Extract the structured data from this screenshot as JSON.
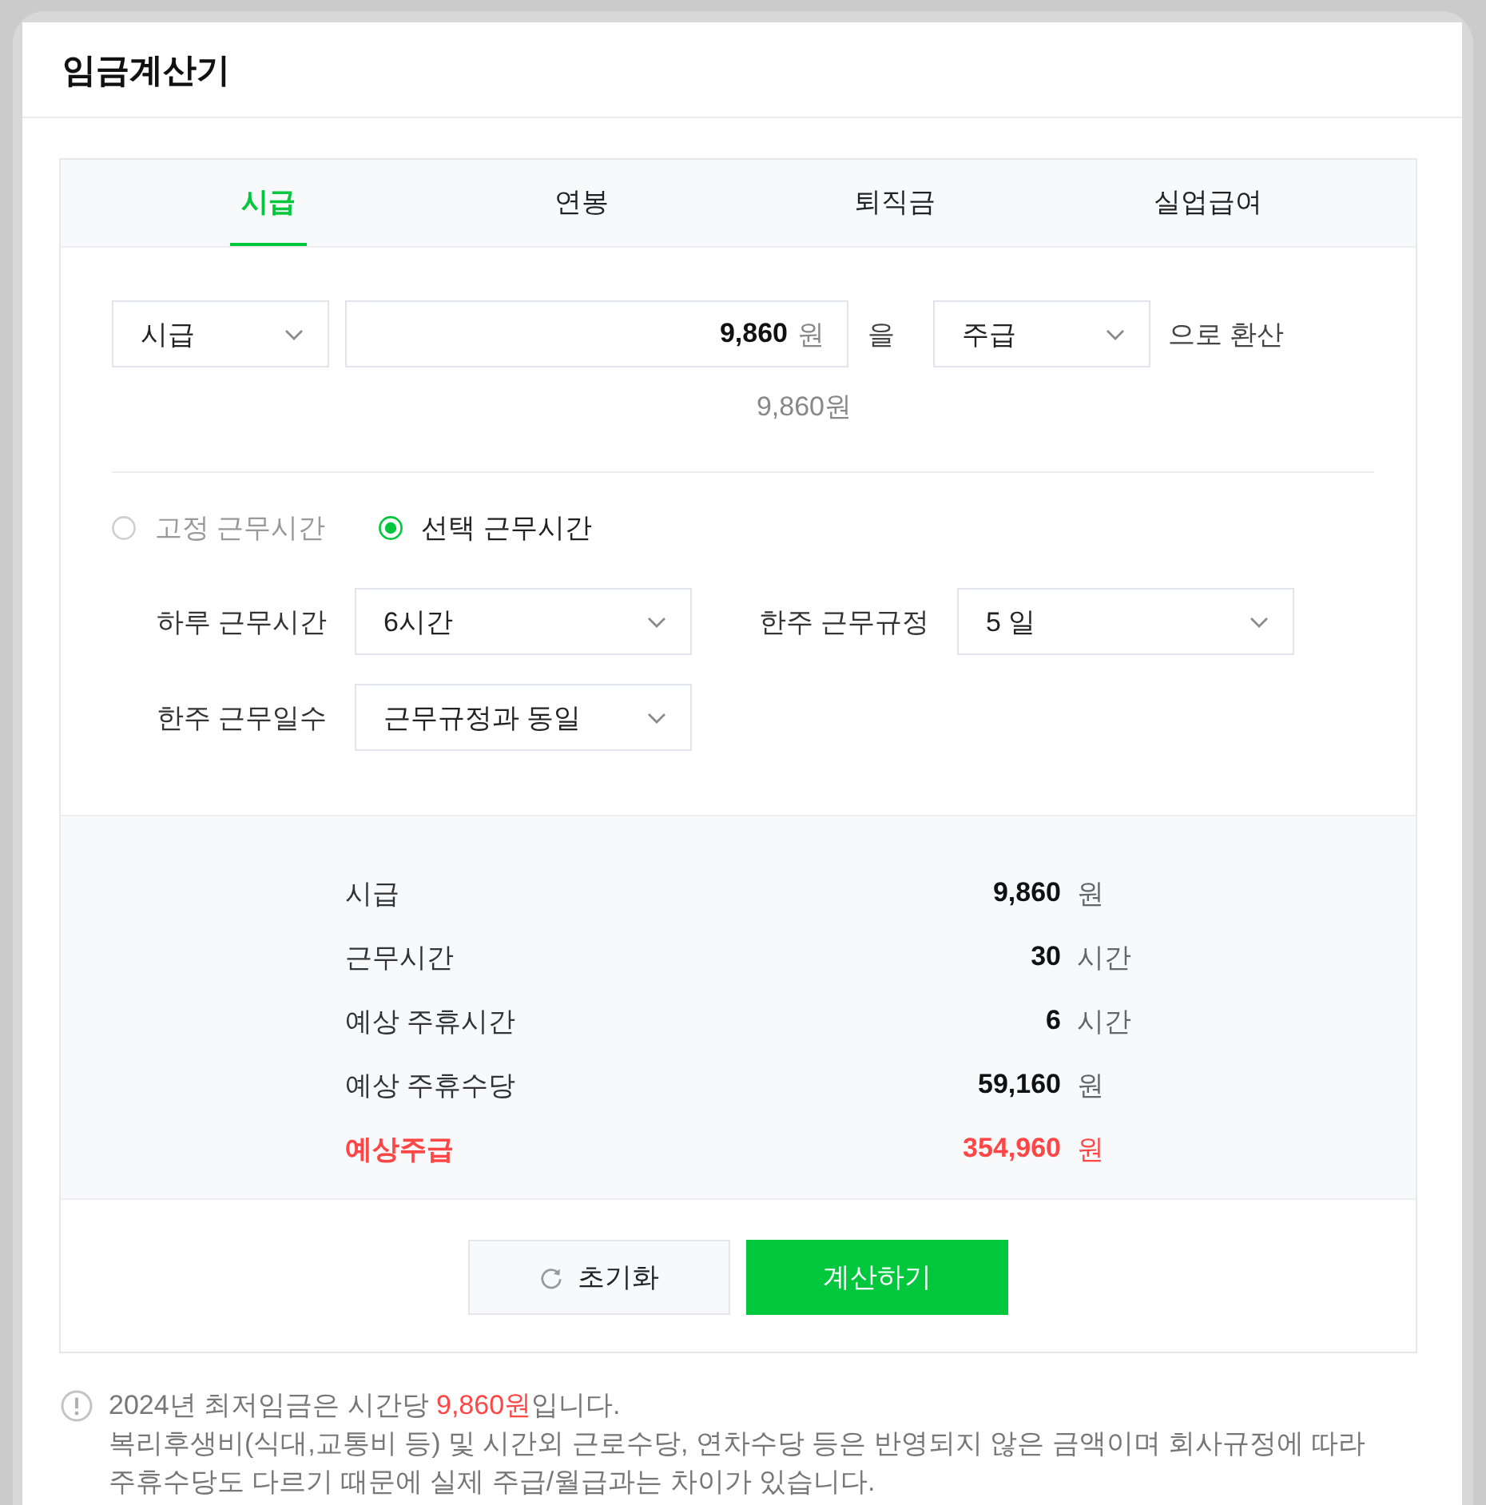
{
  "window": {
    "title": "임금계산기"
  },
  "tabs": [
    {
      "label": "시급",
      "selected": true
    },
    {
      "label": "연봉",
      "selected": false
    },
    {
      "label": "퇴직금",
      "selected": false
    },
    {
      "label": "실업급여",
      "selected": false
    }
  ],
  "converter": {
    "from_select": {
      "value": "시급"
    },
    "amount": {
      "value": "9,860",
      "unit": "원"
    },
    "particle": "을",
    "to_select": {
      "value": "주급"
    },
    "suffix": "으로 환산",
    "amount_preview": "9,860원"
  },
  "work_type": [
    {
      "label": "고정 근무시간",
      "selected": false
    },
    {
      "label": "선택 근무시간",
      "selected": true
    }
  ],
  "fields": [
    {
      "label": "하루 근무시간",
      "value": "6시간"
    },
    {
      "label": "한주 근무규정",
      "value": "5 일"
    },
    {
      "label": "한주 근무일수",
      "value": "근무규정과 동일"
    }
  ],
  "results": [
    {
      "label": "시급",
      "value": "9,860",
      "unit": "원",
      "highlight": false
    },
    {
      "label": "근무시간",
      "value": "30",
      "unit": "시간",
      "highlight": false
    },
    {
      "label": "예상 주휴시간",
      "value": "6",
      "unit": "시간",
      "highlight": false
    },
    {
      "label": "예상 주휴수당",
      "value": "59,160",
      "unit": "원",
      "highlight": false
    },
    {
      "label": "예상주급",
      "value": "354,960",
      "unit": "원",
      "highlight": true
    }
  ],
  "buttons": [
    {
      "kind": "reset",
      "label": "초기화"
    },
    {
      "kind": "primary",
      "label": "계산하기"
    }
  ],
  "notice": {
    "lines": [
      {
        "parts": [
          {
            "text": "2024년 최저임금은 시간당 ",
            "highlight": false
          },
          {
            "text": "9,860원",
            "highlight": true
          },
          {
            "text": "입니다.",
            "highlight": false
          }
        ]
      },
      {
        "parts": [
          {
            "text": "복리후생비(식대,교통비 등) 및 시간외 근로수당, 연차수당 등은 반영되지 않은 금액이며 회사규정에 따라 주휴수당도 다르기 때문에 실제 주급/월급과는 차이가 있습니다.",
            "highlight": false
          }
        ]
      }
    ]
  }
}
